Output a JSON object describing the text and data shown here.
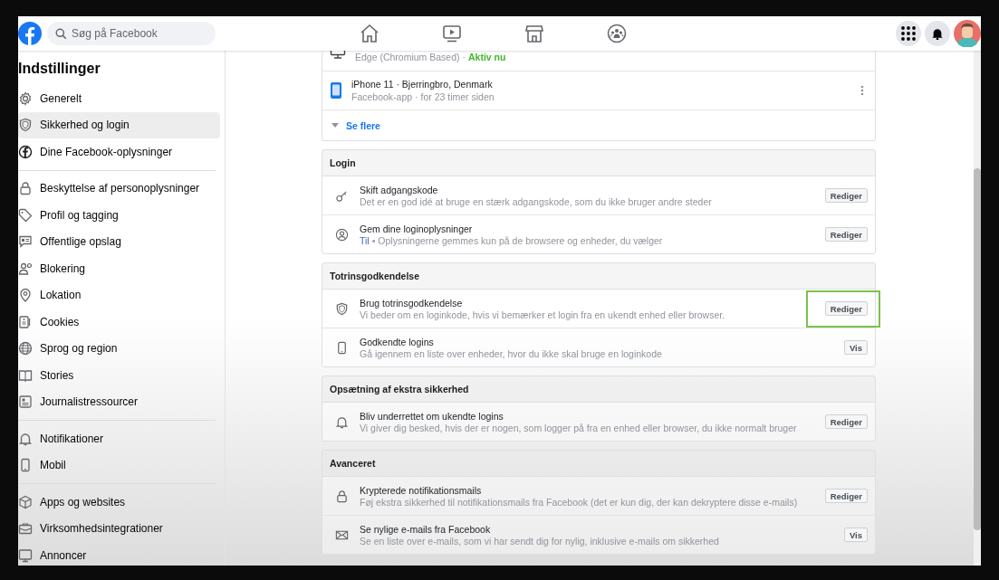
{
  "topbar": {
    "search": {
      "placeholder": "Søg på Facebook"
    }
  },
  "sidebar": {
    "title": "Indstillinger",
    "groups": [
      [
        {
          "label": "Generelt",
          "selected": false
        },
        {
          "label": "Sikkerhed og login",
          "selected": true
        },
        {
          "label": "Dine Facebook-oplysninger",
          "selected": false
        }
      ],
      [
        {
          "label": "Beskyttelse af personoplysninger",
          "selected": false
        },
        {
          "label": "Profil og tagging",
          "selected": false
        },
        {
          "label": "Offentlige opslag",
          "selected": false
        },
        {
          "label": "Blokering",
          "selected": false
        },
        {
          "label": "Lokation",
          "selected": false
        },
        {
          "label": "Cookies",
          "selected": false
        },
        {
          "label": "Sprog og region",
          "selected": false
        },
        {
          "label": "Stories",
          "selected": false
        },
        {
          "label": "Journalistressourcer",
          "selected": false
        }
      ],
      [
        {
          "label": "Notifikationer",
          "selected": false
        },
        {
          "label": "Mobil",
          "selected": false
        }
      ],
      [
        {
          "label": "Apps og websites",
          "selected": false
        },
        {
          "label": "Virksomhedsintegrationer",
          "selected": false
        },
        {
          "label": "Annoncer",
          "selected": false
        }
      ]
    ]
  },
  "devices": {
    "rows": [
      {
        "detail": "Edge (Chromium Based) ·",
        "status": "Aktiv nu",
        "menu": false
      },
      {
        "title": "iPhone 11 · Bjerringbro, Denmark",
        "detail": "Facebook-app · for 23 timer siden",
        "menu": true
      }
    ],
    "see_more": "Se flere"
  },
  "sections": [
    {
      "title": "Login",
      "rows": [
        {
          "title": "Skift adgangskode",
          "description": "Det er en god idé at bruge en stærk adgangskode, som du ikke bruger andre steder",
          "button": "Rediger",
          "highlighted": false
        },
        {
          "title": "Gem dine loginoplysninger",
          "status": "Til",
          "description": "• Oplysningerne gemmes kun på de browsere og enheder, du vælger",
          "button": "Rediger",
          "highlighted": false
        }
      ]
    },
    {
      "title": "Totrinsgodkendelse",
      "rows": [
        {
          "title": "Brug totrinsgodkendelse",
          "description": "Vi beder om en loginkode, hvis vi bemærker et login fra en ukendt enhed eller browser.",
          "button": "Rediger",
          "highlighted": true
        },
        {
          "title": "Godkendte logins",
          "description": "Gå igennem en liste over enheder, hvor du ikke skal bruge en loginkode",
          "button": "Vis",
          "highlighted": false
        }
      ]
    },
    {
      "title": "Opsætning af ekstra sikkerhed",
      "rows": [
        {
          "title": "Bliv underrettet om ukendte logins",
          "description": "Vi giver dig besked, hvis der er nogen, som logger på fra en enhed eller browser, du ikke normalt bruger",
          "button": "Rediger",
          "highlighted": false
        }
      ]
    },
    {
      "title": "Avanceret",
      "rows": [
        {
          "title": "Krypterede notifikationsmails",
          "description": "Føj ekstra sikkerhed til notifikationsmails fra Facebook (det er kun dig, der kan dekryptere disse e-mails)",
          "button": "Rediger",
          "highlighted": false
        },
        {
          "title": "Se nylige e-mails fra Facebook",
          "description": "Se en liste over e-mails, som vi har sendt dig for nylig, inklusive e-mails om sikkerhed",
          "button": "Vis",
          "highlighted": false
        }
      ]
    }
  ]
}
